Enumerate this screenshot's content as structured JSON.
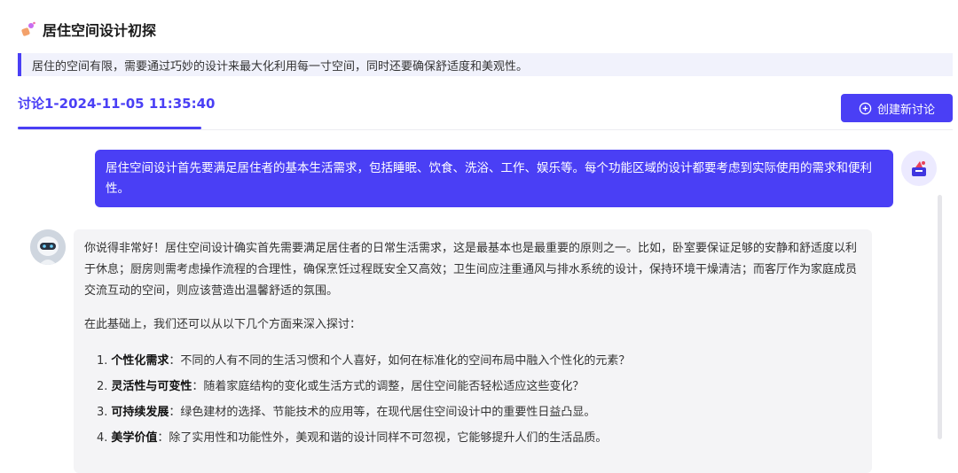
{
  "header": {
    "title": "居住空间设计初探",
    "icon": "sparkle-icon"
  },
  "banner": {
    "text": "居住的空间有限，需要通过巧妙的设计来最大化利用每一寸空间，同时还要确保舒适度和美观性。"
  },
  "tabs": [
    {
      "label": "讨论1-2024-11-05 11:35:40"
    }
  ],
  "toolbar": {
    "new_discussion_label": "创建新讨论"
  },
  "colors": {
    "accent": "#4a3ff5",
    "banner_bg": "#f1f2fc",
    "bot_bubble_bg": "#f4f4f6"
  },
  "messages": {
    "user": {
      "text": "居住空间设计首先要满足居住者的基本生活需求，包括睡眠、饮食、洗浴、工作、娱乐等。每个功能区域的设计都要考虑到实际使用的需求和便利性。"
    },
    "bot": {
      "para1": "你说得非常好！居住空间设计确实首先需要满足居住者的日常生活需求，这是最基本也是最重要的原则之一。比如，卧室要保证足够的安静和舒适度以利于休息；厨房则需考虑操作流程的合理性，确保烹饪过程既安全又高效；卫生间应注重通风与排水系统的设计，保持环境干燥清洁；而客厅作为家庭成员交流互动的空间，则应该营造出温馨舒适的氛围。",
      "para2": "在此基础上，我们还可以从以下几个方面来深入探讨：",
      "items": [
        {
          "num": "1.",
          "term": "个性化需求",
          "desc": "：不同的人有不同的生活习惯和个人喜好，如何在标准化的空间布局中融入个性化的元素？"
        },
        {
          "num": "2.",
          "term": "灵活性与可变性",
          "desc": "：随着家庭结构的变化或生活方式的调整，居住空间能否轻松适应这些变化？"
        },
        {
          "num": "3.",
          "term": "可持续发展",
          "desc": "：绿色建材的选择、节能技术的应用等，在现代居住空间设计中的重要性日益凸显。"
        },
        {
          "num": "4.",
          "term": "美学价值",
          "desc": "：除了实用性和功能性外，美观和谐的设计同样不可忽视，它能够提升人们的生活品质。"
        }
      ]
    }
  }
}
